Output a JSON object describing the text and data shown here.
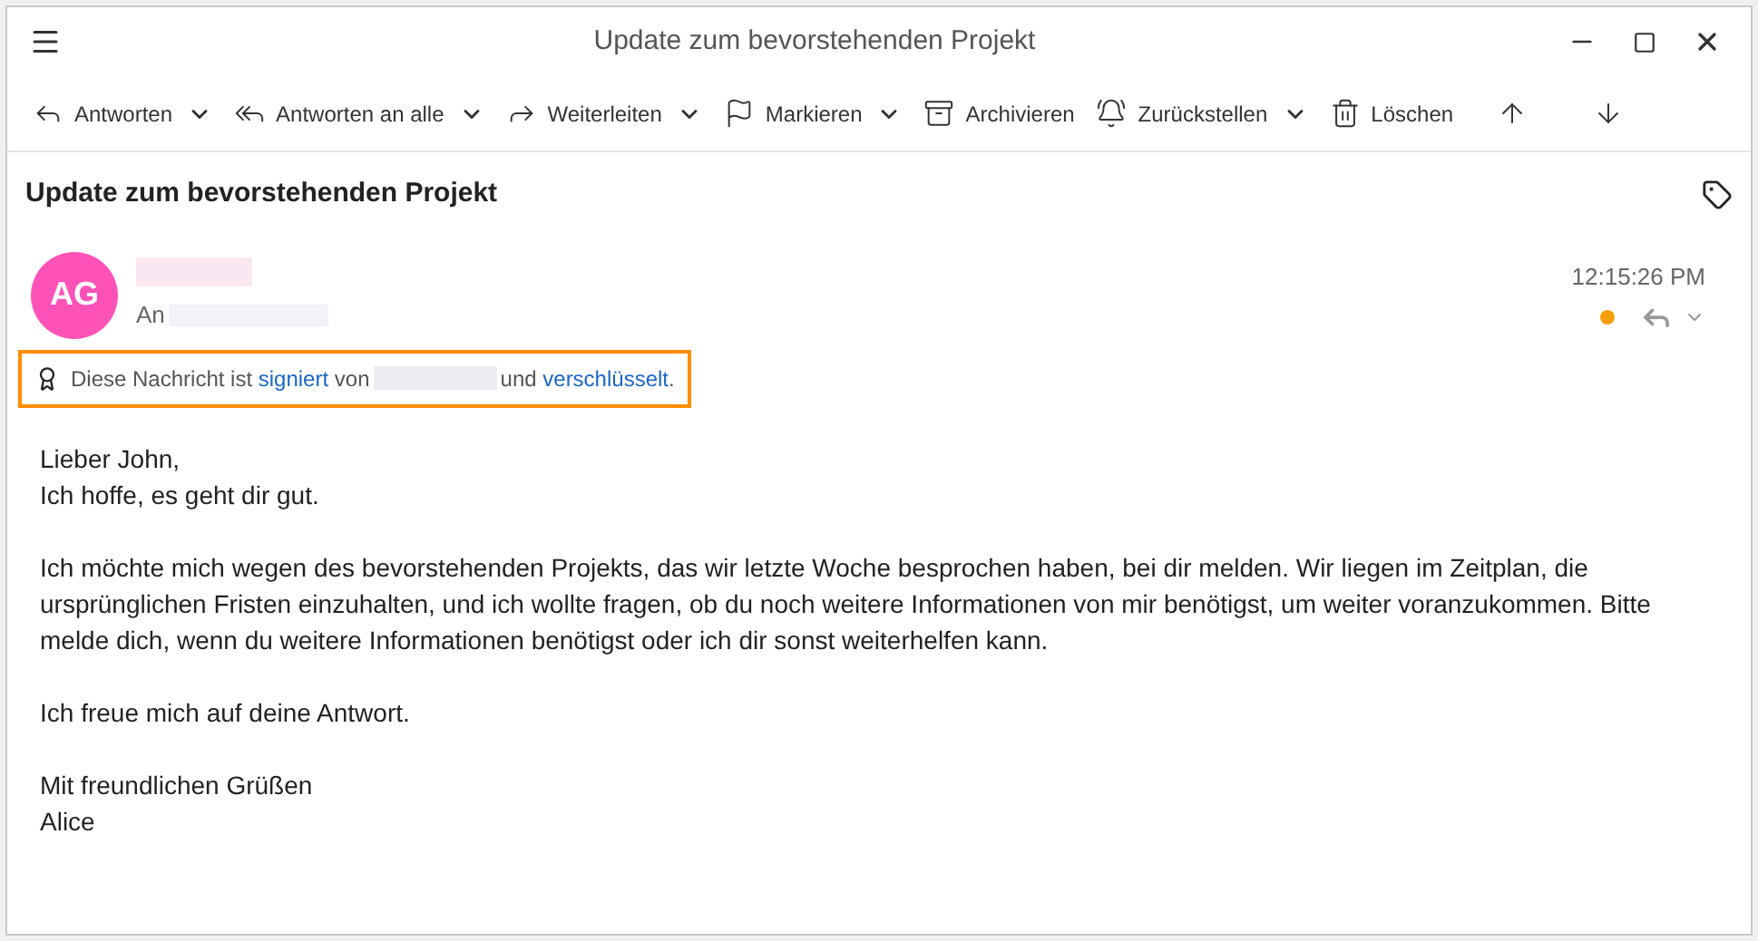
{
  "window": {
    "title": "Update zum bevorstehenden Projekt"
  },
  "toolbar": [
    {
      "label": "Antworten",
      "kind": "reply",
      "dropdown": true
    },
    {
      "label": "Antworten an alle",
      "kind": "reply-all",
      "dropdown": true
    },
    {
      "label": "Weiterleiten",
      "kind": "forward",
      "dropdown": true
    },
    {
      "label": "Markieren",
      "kind": "flag",
      "dropdown": true
    },
    {
      "label": "Archivieren",
      "kind": "archive",
      "dropdown": false
    },
    {
      "label": "Zurückstellen",
      "kind": "snooze",
      "dropdown": true
    },
    {
      "label": "Löschen",
      "kind": "delete",
      "dropdown": false
    },
    {
      "kind": "up",
      "dropdown": false
    },
    {
      "kind": "down",
      "dropdown": false
    }
  ],
  "subject": "Update zum bevorstehenden Projekt",
  "sender": {
    "initials": "AG",
    "to_label": "An",
    "time": "12:15:26 PM",
    "unread": true
  },
  "security": {
    "prefix": "Diese Nachricht ist",
    "signed_link": "signiert",
    "by": "von",
    "and": "und",
    "encrypted_link": "verschlüsselt",
    "end": "."
  },
  "body": [
    "Lieber John,\nIch hoffe, es geht dir gut.",
    "Ich möchte mich wegen des bevorstehenden Projekts, das wir letzte Woche besprochen haben, bei dir melden. Wir liegen im Zeitplan, die ursprünglichen Fristen einzuhalten, und ich wollte fragen, ob du noch weitere Informationen von mir benötigst, um weiter voranzukommen. Bitte melde dich, wenn du weitere Informationen benötigst oder ich dir sonst weiterhelfen kann.",
    "Ich freue mich auf deine Antwort.",
    "Mit freundlichen Grüßen\nAlice"
  ]
}
